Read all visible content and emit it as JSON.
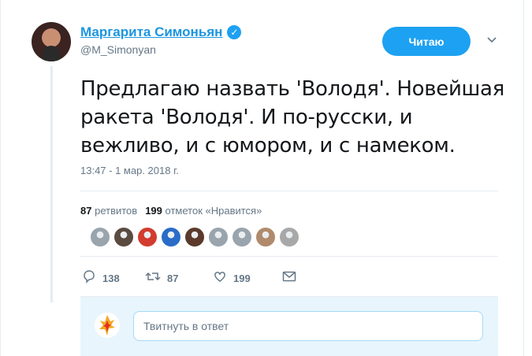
{
  "author": {
    "name": "Маргарита Симоньян",
    "handle": "@M_Simonyan",
    "verified_icon": "verified-badge"
  },
  "follow_button": {
    "label": "Читаю"
  },
  "tweet": {
    "lines": [
      "Предлагаю назвать 'Володя'. Новейшая",
      "ракета 'Володя'. И по-русски, и",
      "вежливо, и с юмором, и с намеком."
    ],
    "timestamp": "13:47 - 1 мар. 2018 г."
  },
  "stats": {
    "retweets_count": "87",
    "retweets_label": "ретвитов",
    "likes_count": "199",
    "likes_label": "отметок «Нравится»"
  },
  "likers": [
    "#9aa4ad",
    "#5a4a40",
    "#d33b2f",
    "#2a6cc7",
    "#5b3a2c",
    "#9aa4ad",
    "#9aa4ad",
    "#b08a6c",
    "#a8a8a8"
  ],
  "actions": {
    "replies": "138",
    "retweets": "87",
    "likes": "199"
  },
  "reply": {
    "placeholder": "Твитнуть в ответ"
  },
  "colors": {
    "accent": "#1da1f2",
    "link": "#1b95e0",
    "muted": "#657786"
  }
}
